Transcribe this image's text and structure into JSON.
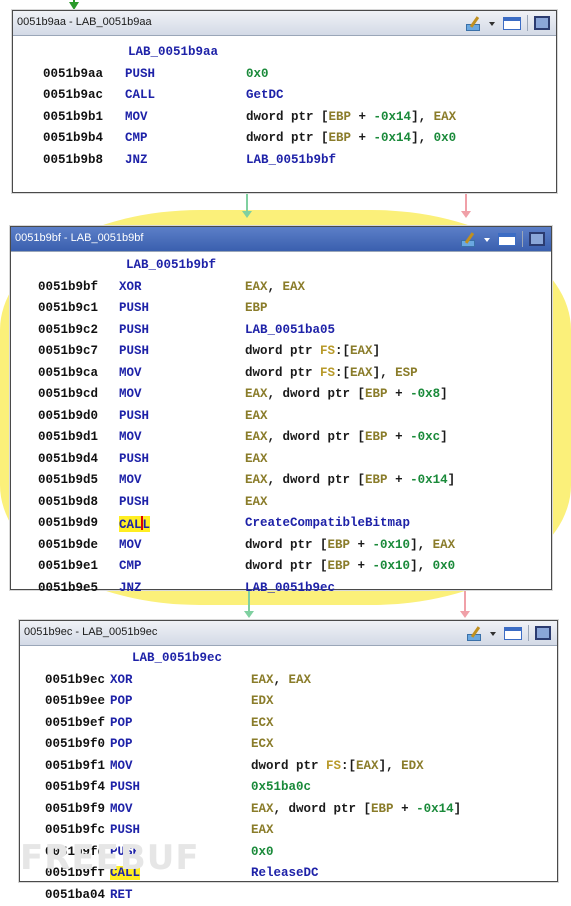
{
  "blocks": [
    {
      "title": "0051b9aa - LAB_0051b9aa",
      "label": "LAB_0051b9aa",
      "rows": [
        {
          "addr": "0051b9aa",
          "mn": "PUSH",
          "ops": [
            {
              "t": "imm",
              "v": "0x0"
            }
          ]
        },
        {
          "addr": "0051b9ac",
          "mn": "CALL",
          "ops": [
            {
              "t": "sym",
              "v": "GetDC"
            }
          ]
        },
        {
          "addr": "0051b9b1",
          "mn": "MOV",
          "ops": [
            {
              "t": "txt",
              "v": "dword ptr ["
            },
            {
              "t": "reg",
              "v": "EBP"
            },
            {
              "t": "txt",
              "v": " + "
            },
            {
              "t": "imm",
              "v": "-0x14"
            },
            {
              "t": "txt",
              "v": "], "
            },
            {
              "t": "reg",
              "v": "EAX"
            }
          ]
        },
        {
          "addr": "0051b9b4",
          "mn": "CMP",
          "ops": [
            {
              "t": "txt",
              "v": "dword ptr ["
            },
            {
              "t": "reg",
              "v": "EBP"
            },
            {
              "t": "txt",
              "v": " + "
            },
            {
              "t": "imm",
              "v": "-0x14"
            },
            {
              "t": "txt",
              "v": "], "
            },
            {
              "t": "imm",
              "v": "0x0"
            }
          ]
        },
        {
          "addr": "0051b9b8",
          "mn": "JNZ",
          "ops": [
            {
              "t": "sym",
              "v": "LAB_0051b9bf"
            }
          ]
        }
      ]
    },
    {
      "title": "0051b9bf - LAB_0051b9bf",
      "label": "LAB_0051b9bf",
      "rows": [
        {
          "addr": "0051b9bf",
          "mn": "XOR",
          "ops": [
            {
              "t": "reg",
              "v": "EAX"
            },
            {
              "t": "txt",
              "v": ", "
            },
            {
              "t": "reg",
              "v": "EAX"
            }
          ]
        },
        {
          "addr": "0051b9c1",
          "mn": "PUSH",
          "ops": [
            {
              "t": "reg",
              "v": "EBP"
            }
          ]
        },
        {
          "addr": "0051b9c2",
          "mn": "PUSH",
          "ops": [
            {
              "t": "sym",
              "v": "LAB_0051ba05"
            }
          ]
        },
        {
          "addr": "0051b9c7",
          "mn": "PUSH",
          "ops": [
            {
              "t": "txt",
              "v": "dword ptr "
            },
            {
              "t": "seg",
              "v": "FS"
            },
            {
              "t": "txt",
              "v": ":["
            },
            {
              "t": "reg",
              "v": "EAX"
            },
            {
              "t": "txt",
              "v": "]"
            }
          ]
        },
        {
          "addr": "0051b9ca",
          "mn": "MOV",
          "ops": [
            {
              "t": "txt",
              "v": "dword ptr "
            },
            {
              "t": "seg",
              "v": "FS"
            },
            {
              "t": "txt",
              "v": ":["
            },
            {
              "t": "reg",
              "v": "EAX"
            },
            {
              "t": "txt",
              "v": "], "
            },
            {
              "t": "reg",
              "v": "ESP"
            }
          ]
        },
        {
          "addr": "0051b9cd",
          "mn": "MOV",
          "ops": [
            {
              "t": "reg",
              "v": "EAX"
            },
            {
              "t": "txt",
              "v": ", dword ptr ["
            },
            {
              "t": "reg",
              "v": "EBP"
            },
            {
              "t": "txt",
              "v": " + "
            },
            {
              "t": "imm",
              "v": "-0x8"
            },
            {
              "t": "txt",
              "v": "]"
            }
          ]
        },
        {
          "addr": "0051b9d0",
          "mn": "PUSH",
          "ops": [
            {
              "t": "reg",
              "v": "EAX"
            }
          ]
        },
        {
          "addr": "0051b9d1",
          "mn": "MOV",
          "ops": [
            {
              "t": "reg",
              "v": "EAX"
            },
            {
              "t": "txt",
              "v": ", dword ptr ["
            },
            {
              "t": "reg",
              "v": "EBP"
            },
            {
              "t": "txt",
              "v": " + "
            },
            {
              "t": "imm",
              "v": "-0xc"
            },
            {
              "t": "txt",
              "v": "]"
            }
          ]
        },
        {
          "addr": "0051b9d4",
          "mn": "PUSH",
          "ops": [
            {
              "t": "reg",
              "v": "EAX"
            }
          ]
        },
        {
          "addr": "0051b9d5",
          "mn": "MOV",
          "ops": [
            {
              "t": "reg",
              "v": "EAX"
            },
            {
              "t": "txt",
              "v": ", dword ptr ["
            },
            {
              "t": "reg",
              "v": "EBP"
            },
            {
              "t": "txt",
              "v": " + "
            },
            {
              "t": "imm",
              "v": "-0x14"
            },
            {
              "t": "txt",
              "v": "]"
            }
          ]
        },
        {
          "addr": "0051b9d8",
          "mn": "PUSH",
          "ops": [
            {
              "t": "reg",
              "v": "EAX"
            }
          ]
        },
        {
          "addr": "0051b9d9",
          "mn": "CALL",
          "hl": true,
          "cursor": true,
          "ops": [
            {
              "t": "sym",
              "v": "CreateCompatibleBitmap"
            }
          ]
        },
        {
          "addr": "0051b9de",
          "mn": "MOV",
          "ops": [
            {
              "t": "txt",
              "v": "dword ptr ["
            },
            {
              "t": "reg",
              "v": "EBP"
            },
            {
              "t": "txt",
              "v": " + "
            },
            {
              "t": "imm",
              "v": "-0x10"
            },
            {
              "t": "txt",
              "v": "], "
            },
            {
              "t": "reg",
              "v": "EAX"
            }
          ]
        },
        {
          "addr": "0051b9e1",
          "mn": "CMP",
          "ops": [
            {
              "t": "txt",
              "v": "dword ptr ["
            },
            {
              "t": "reg",
              "v": "EBP"
            },
            {
              "t": "txt",
              "v": " + "
            },
            {
              "t": "imm",
              "v": "-0x10"
            },
            {
              "t": "txt",
              "v": "], "
            },
            {
              "t": "imm",
              "v": "0x0"
            }
          ]
        },
        {
          "addr": "0051b9e5",
          "mn": "JNZ",
          "ops": [
            {
              "t": "sym",
              "v": "LAB_0051b9ec"
            }
          ]
        }
      ]
    },
    {
      "title": "0051b9ec - LAB_0051b9ec",
      "label": "LAB_0051b9ec",
      "rows": [
        {
          "addr": "0051b9ec",
          "mn": "XOR",
          "ops": [
            {
              "t": "reg",
              "v": "EAX"
            },
            {
              "t": "txt",
              "v": ", "
            },
            {
              "t": "reg",
              "v": "EAX"
            }
          ]
        },
        {
          "addr": "0051b9ee",
          "mn": "POP",
          "ops": [
            {
              "t": "reg",
              "v": "EDX"
            }
          ]
        },
        {
          "addr": "0051b9ef",
          "mn": "POP",
          "ops": [
            {
              "t": "reg",
              "v": "ECX"
            }
          ]
        },
        {
          "addr": "0051b9f0",
          "mn": "POP",
          "ops": [
            {
              "t": "reg",
              "v": "ECX"
            }
          ]
        },
        {
          "addr": "0051b9f1",
          "mn": "MOV",
          "ops": [
            {
              "t": "txt",
              "v": "dword ptr "
            },
            {
              "t": "seg",
              "v": "FS"
            },
            {
              "t": "txt",
              "v": ":["
            },
            {
              "t": "reg",
              "v": "EAX"
            },
            {
              "t": "txt",
              "v": "], "
            },
            {
              "t": "reg",
              "v": "EDX"
            }
          ]
        },
        {
          "addr": "0051b9f4",
          "mn": "PUSH",
          "ops": [
            {
              "t": "imm",
              "v": "0x51ba0c"
            }
          ]
        },
        {
          "addr": "0051b9f9",
          "mn": "MOV",
          "ops": [
            {
              "t": "reg",
              "v": "EAX"
            },
            {
              "t": "txt",
              "v": ", dword ptr ["
            },
            {
              "t": "reg",
              "v": "EBP"
            },
            {
              "t": "txt",
              "v": " + "
            },
            {
              "t": "imm",
              "v": "-0x14"
            },
            {
              "t": "txt",
              "v": "]"
            }
          ]
        },
        {
          "addr": "0051b9fc",
          "mn": "PUSH",
          "ops": [
            {
              "t": "reg",
              "v": "EAX"
            }
          ]
        },
        {
          "addr": "0051b9fd",
          "mn": "PUSH",
          "ops": [
            {
              "t": "imm",
              "v": "0x0"
            }
          ]
        },
        {
          "addr": "0051b9ff",
          "mn": "CALL",
          "hl": true,
          "ops": [
            {
              "t": "sym",
              "v": "ReleaseDC"
            }
          ]
        },
        {
          "addr": "0051ba04",
          "mn": "RET",
          "ops": []
        }
      ]
    }
  ],
  "watermark": "FREEBUF",
  "icons": [
    "edit-icon",
    "dropdown-icon",
    "window-icon",
    "maximize-icon"
  ],
  "colors": {
    "mnemonic": "#1e22a8",
    "register": "#8a7c2a",
    "immediate": "#1a8a3a",
    "highlight": "#ffee22",
    "active_titlebar": "#3a5fae",
    "current_block_glow": "#fbf07a"
  }
}
